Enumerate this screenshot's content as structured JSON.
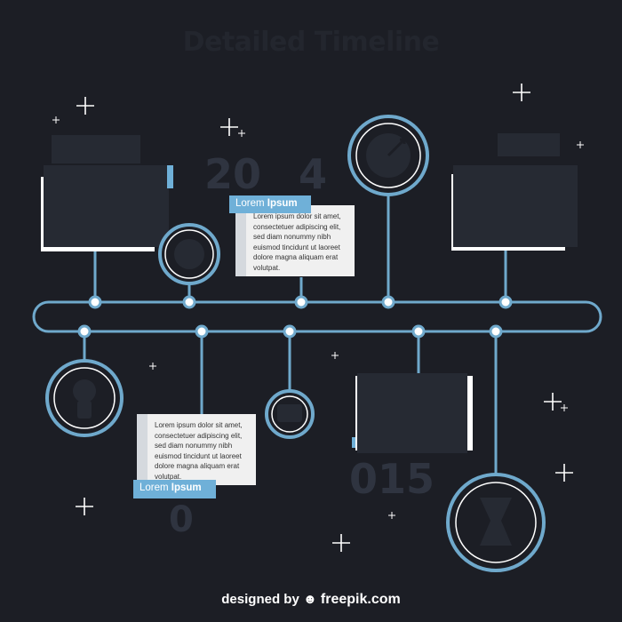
{
  "title": "Detailed Timeline",
  "years": {
    "top_partial": "20",
    "top_partial_digit": "4",
    "bottom_right": "015",
    "bottom_left": "0"
  },
  "cards": [
    {
      "tag_regular": "Lorem ",
      "tag_bold": "Ipsum",
      "body": "Lorem ipsum dolor sit amet, consectetuer adipiscing elit, sed diam nonummy nibh euismod tincidunt ut laoreet dolore magna aliquam erat volutpat."
    },
    {
      "tag_regular": "Lorem ",
      "tag_bold": "Ipsum",
      "body": "Lorem ipsum dolor sit amet, consectetuer adipiscing elit, sed diam nonummy nibh euismod tincidunt ut laoreet dolore magna aliquam erat volutpat."
    }
  ],
  "credit": {
    "prefix": "designed by ",
    "brand": "freepik.com"
  },
  "colors": {
    "background": "#1c1e25",
    "line": "#6fa9cc",
    "panel": "#262a33",
    "card": "#f0f0f0",
    "tag": "#6fb0d8",
    "sparkle": "#ffffff"
  },
  "icons": [
    "dart-icon",
    "apple-icon",
    "trophy-icon",
    "chat-icon",
    "lightbulb-icon",
    "hourglass-icon"
  ]
}
